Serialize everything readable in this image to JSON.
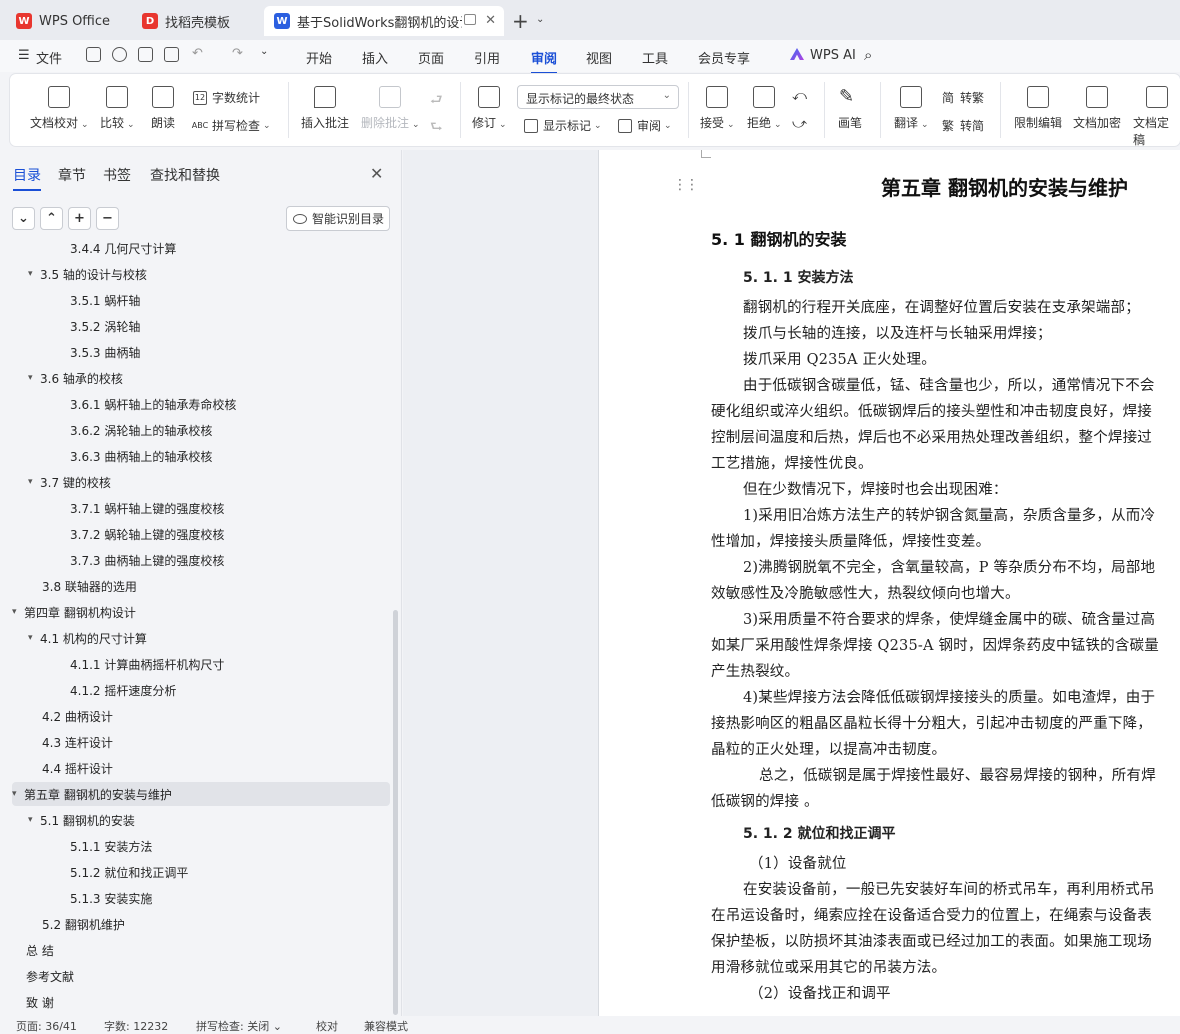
{
  "tabs": [
    {
      "label": "WPS Office",
      "icon": "wps-logo-icon",
      "color": "#e8362f"
    },
    {
      "label": "找稻壳模板",
      "icon": "docer-icon",
      "color": "#e8362f"
    },
    {
      "label": "基于SolidWorks翻钢机的设计",
      "icon": "writer-doc-icon",
      "color": "#2b5fe0"
    }
  ],
  "menu": {
    "file": "文件",
    "items": [
      "开始",
      "插入",
      "页面",
      "引用",
      "审阅",
      "视图",
      "工具",
      "会员专享"
    ],
    "active": "审阅",
    "wps_ai": "WPS AI"
  },
  "ribbon": {
    "doc_check": "文档校对",
    "compare": "比较",
    "read_aloud": "朗读",
    "word_count": "字数统计",
    "spell_check": "拼写检查",
    "insert_comment": "插入批注",
    "delete_comment": "删除批注",
    "track_changes": "修订",
    "markup_state": "显示标记的最终状态",
    "show_markup": "显示标记",
    "review_pane": "审阅",
    "accept": "接受",
    "reject": "拒绝",
    "ink": "画笔",
    "translate": "翻译",
    "to_traditional": "转繁",
    "to_simplified": "转简",
    "restrict_edit": "限制编辑",
    "doc_encrypt": "文档加密",
    "doc_final": "文档定稿"
  },
  "panel": {
    "tabs": [
      "目录",
      "章节",
      "书签",
      "查找和替换"
    ],
    "smart_toc": "智能识别目录",
    "toc": [
      {
        "text": "3.4.4 几何尺寸计算",
        "level": 3
      },
      {
        "text": "3.5 轴的设计与校核",
        "level": 2,
        "caret": "▾"
      },
      {
        "text": "3.5.1 蜗杆轴",
        "level": 3
      },
      {
        "text": "3.5.2 涡轮轴",
        "level": 3
      },
      {
        "text": "3.5.3 曲柄轴",
        "level": 3
      },
      {
        "text": "3.6 轴承的校核",
        "level": 2,
        "caret": "▾"
      },
      {
        "text": "3.6.1 蜗杆轴上的轴承寿命校核",
        "level": 3
      },
      {
        "text": "3.6.2 涡轮轴上的轴承校核",
        "level": 3
      },
      {
        "text": "3.6.3 曲柄轴上的轴承校核",
        "level": 3
      },
      {
        "text": "3.7 键的校核",
        "level": 2,
        "caret": "▾"
      },
      {
        "text": "3.7.1 蜗杆轴上键的强度校核",
        "level": 3
      },
      {
        "text": "3.7.2 蜗轮轴上键的强度校核",
        "level": 3
      },
      {
        "text": "3.7.3 曲柄轴上键的强度校核",
        "level": 3
      },
      {
        "text": "3.8 联轴器的选用",
        "level": 2
      },
      {
        "text": "第四章  翻钢机构设计",
        "level": 1,
        "caret": "▾"
      },
      {
        "text": "4.1 机构的尺寸计算",
        "level": 2,
        "caret": "▾"
      },
      {
        "text": "4.1.1 计算曲柄摇杆机构尺寸",
        "level": 3
      },
      {
        "text": "4.1.2 摇杆速度分析",
        "level": 3
      },
      {
        "text": "4.2 曲柄设计",
        "level": 2
      },
      {
        "text": "4.3 连杆设计",
        "level": 2
      },
      {
        "text": "4.4 摇杆设计",
        "level": 2
      },
      {
        "text": "第五章  翻钢机的安装与维护",
        "level": 1,
        "caret": "▾",
        "selected": true
      },
      {
        "text": "5.1 翻钢机的安装",
        "level": 2,
        "caret": "▾"
      },
      {
        "text": "5.1.1 安装方法",
        "level": 3
      },
      {
        "text": "5.1.2 就位和找正调平",
        "level": 3
      },
      {
        "text": "5.1.3 安装实施",
        "level": 3
      },
      {
        "text": "5.2 翻钢机维护",
        "level": 2
      },
      {
        "text": "总  结",
        "level": 1
      },
      {
        "text": "参考文献",
        "level": 1
      },
      {
        "text": "致  谢",
        "level": 1
      }
    ]
  },
  "document": {
    "chapter_title": "第五章  翻钢机的安装与维护",
    "section_title": "5. 1 翻钢机的安装",
    "subsection_1": "5. 1. 1 安装方法",
    "subsection_2": "5. 1. 2 就位和找正调平",
    "body": [
      "翻钢机的行程开关底座，在调整好位置后安装在支承架端部；",
      "拨爪与长轴的连接，以及连杆与长轴采用焊接；",
      "拨爪采用 Q235A 正火处理。",
      "由于低碳钢含碳量低，锰、硅含量也少，所以，通常情况下不会",
      "硬化组织或淬火组织。低碳钢焊后的接头塑性和冲击韧度良好，焊接",
      "控制层间温度和后热，焊后也不必采用热处理改善组织，整个焊接过",
      "工艺措施，焊接性优良。",
      "但在少数情况下，焊接时也会出现困难：",
      "1)采用旧冶炼方法生产的转炉钢含氮量高，杂质含量多，从而冷",
      "性增加，焊接接头质量降低，焊接性变差。",
      "2)沸腾钢脱氧不完全，含氧量较高，P 等杂质分布不均，局部地",
      "效敏感性及冷脆敏感性大，热裂纹倾向也增大。",
      "3)采用质量不符合要求的焊条，使焊缝金属中的碳、硫含量过高",
      "如某厂采用酸性焊条焊接 Q235-A 钢时，因焊条药皮中锰铁的含碳量",
      "产生热裂纹。",
      "4)某些焊接方法会降低低碳钢焊接接头的质量。如电渣焊，由于",
      "接热影响区的粗晶区晶粒长得十分粗大，引起冲击韧度的严重下降，",
      "晶粒的正火处理，以提高冲击韧度。",
      "总之，低碳钢是属于焊接性最好、最容易焊接的钢种，所有焊",
      "低碳钢的焊接  。"
    ],
    "body2": [
      "（1）设备就位",
      "在安装设备前，一般已先安装好车间的桥式吊车，再利用桥式吊",
      "在吊运设备时，绳索应拴在设备适合受力的位置上，在绳索与设备表",
      "保护垫板，以防损坏其油漆表面或已经过加工的表面。如果施工现场",
      "用滑移就位或采用其它的吊装方法。",
      "（2）设备找正和调平"
    ]
  },
  "status": {
    "page": "页面: 36/41",
    "word_count": "字数: 12232",
    "spell_check": "拼写检查: 关闭",
    "proofread": "校对",
    "compat_mode": "兼容模式"
  }
}
